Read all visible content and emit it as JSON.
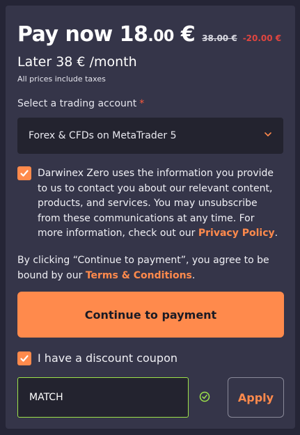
{
  "pricing": {
    "pay_now_label": "Pay now",
    "pay_now_int": "18",
    "pay_now_cents": ".00",
    "currency": "€",
    "old_price": "38.00 €",
    "discount": "-20.00 €",
    "later": "Later 38 € /month",
    "taxes_note": "All prices include taxes"
  },
  "account": {
    "label": "Select a trading account",
    "required_mark": "*",
    "selected": "Forex & CFDs on MetaTrader 5",
    "chevron_icon": "chevron-down-icon"
  },
  "consent": {
    "checked": true,
    "text": "Darwinex Zero uses the information you provide to us to contact you about our relevant content, products, and services. You may unsubscribe from these communications at any time. For more information, check out our ",
    "link": "Privacy Policy",
    "end": "."
  },
  "terms": {
    "text": "By clicking “Continue to payment”, you agree to be bound by our ",
    "link": "Terms & Conditions",
    "end": "."
  },
  "continue_button": "Continue to payment",
  "coupon": {
    "checked": true,
    "label": "I have a discount coupon",
    "value": "MATCH",
    "valid_icon": "check-circle-icon",
    "apply_label": "Apply"
  },
  "colors": {
    "accent": "#ff8a4c",
    "discount": "#e0453f",
    "valid": "#9ee34a",
    "card": "#353549",
    "background": "#252536"
  }
}
